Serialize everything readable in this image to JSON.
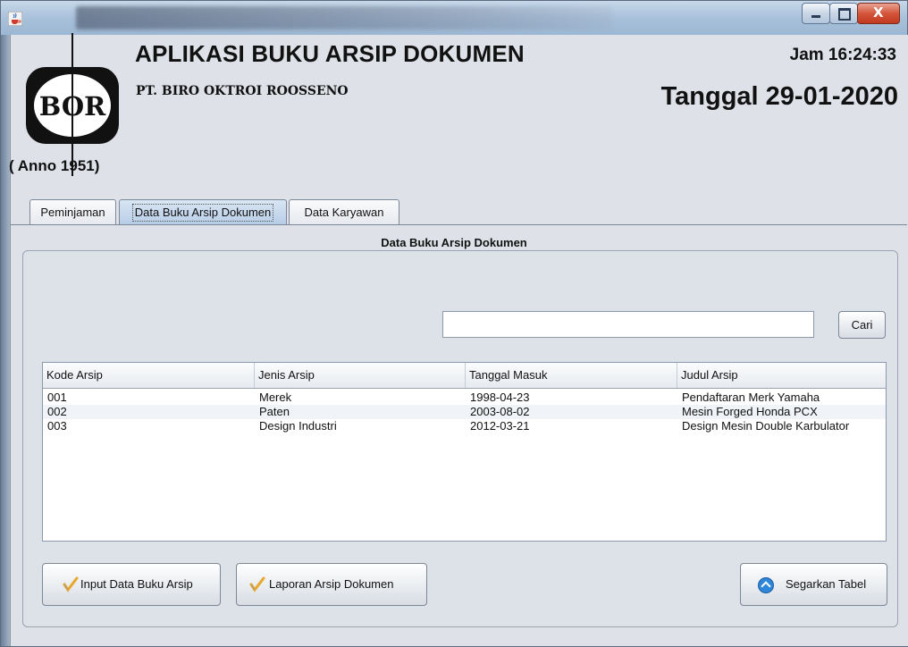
{
  "app": {
    "title": "APLIKASI BUKU ARSIP DOKUMEN",
    "company": "PT. BIRO OKTROI ROOSSENO",
    "logo_text": "BOR",
    "anno": "( Anno 1951)",
    "clock": "Jam 16:24:33",
    "date": "Tanggal 29-01-2020"
  },
  "tabs": [
    {
      "label": "Peminjaman",
      "active": false
    },
    {
      "label": "Data Buku Arsip Dokumen",
      "active": true
    },
    {
      "label": "Data Karyawan",
      "active": false
    }
  ],
  "panel": {
    "title": "Data Buku Arsip Dokumen"
  },
  "search": {
    "value": "",
    "button_label": "Cari"
  },
  "table": {
    "columns": [
      "Kode Arsip",
      "Jenis Arsip",
      "Tanggal Masuk",
      "Judul Arsip"
    ],
    "rows": [
      [
        "001",
        "Merek",
        "1998-04-23",
        "Pendaftaran Merk Yamaha"
      ],
      [
        "002",
        "Paten",
        "2003-08-02",
        "Mesin Forged Honda PCX"
      ],
      [
        "003",
        "Design Industri",
        "2012-03-21",
        "Design Mesin Double Karbulator"
      ]
    ]
  },
  "actions": {
    "input_label": "Input Data Buku Arsip",
    "laporan_label": "Laporan Arsip Dokumen",
    "segarkan_label": "Segarkan Tabel"
  },
  "icons": {
    "window": "java-cup-icon",
    "pencil": "pencil-icon",
    "refresh": "refresh-icon"
  },
  "colors": {
    "active_tab": "#b7cde6",
    "refresh_icon": "#2e86d9",
    "close_button": "#c13a1f"
  }
}
